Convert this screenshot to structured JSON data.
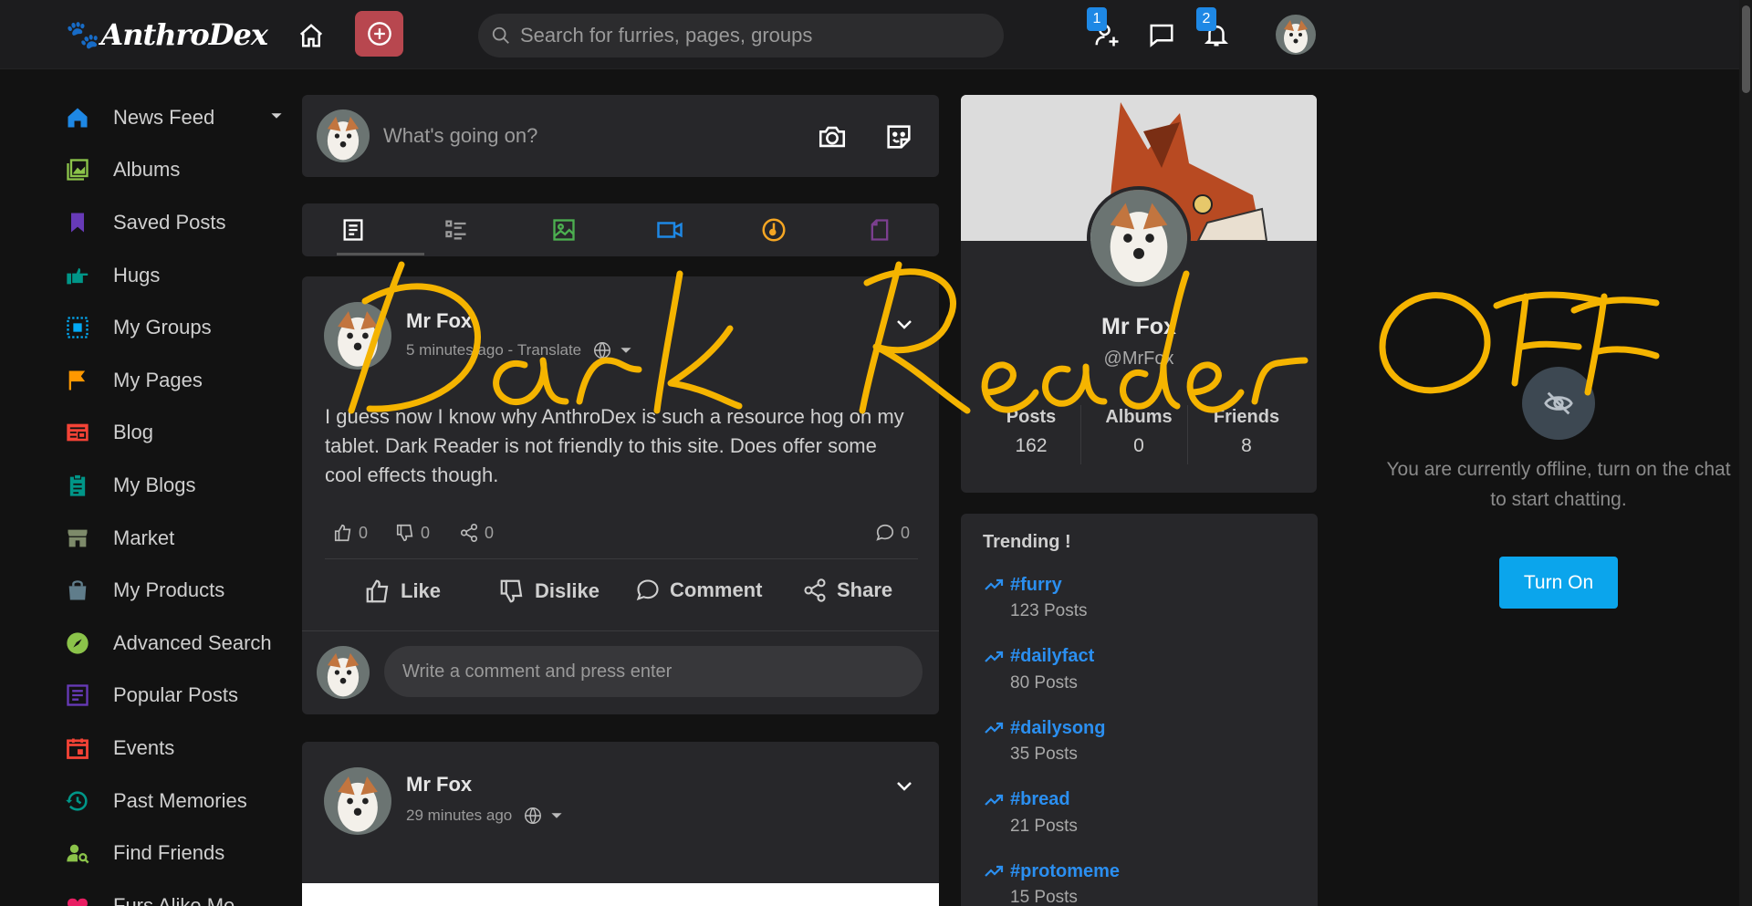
{
  "header": {
    "logo_text": "AnthroDex",
    "search_placeholder": "Search for furries, pages, groups",
    "friend_requests_badge": "1",
    "notifications_badge": "2"
  },
  "sidebar": {
    "items": [
      {
        "label": "News Feed",
        "icon": "home-icon",
        "color": "#1e88e5"
      },
      {
        "label": "Albums",
        "icon": "albums-icon",
        "color": "#8bc34a"
      },
      {
        "label": "Saved Posts",
        "icon": "bookmark-icon",
        "color": "#673ab7"
      },
      {
        "label": "Hugs",
        "icon": "hand-point-icon",
        "color": "#009688"
      },
      {
        "label": "My Groups",
        "icon": "groups-icon",
        "color": "#03a9f4"
      },
      {
        "label": "My Pages",
        "icon": "flag-icon",
        "color": "#ff9800"
      },
      {
        "label": "Blog",
        "icon": "newspaper-icon",
        "color": "#f44336"
      },
      {
        "label": "My Blogs",
        "icon": "clipboard-icon",
        "color": "#009688"
      },
      {
        "label": "Market",
        "icon": "store-icon",
        "color": "#7d8a6a"
      },
      {
        "label": "My Products",
        "icon": "shopping-bag-icon",
        "color": "#607d8b"
      },
      {
        "label": "Advanced Search",
        "icon": "compass-icon",
        "color": "#8bc34a"
      },
      {
        "label": "Popular Posts",
        "icon": "article-icon",
        "color": "#673ab7"
      },
      {
        "label": "Events",
        "icon": "calendar-icon",
        "color": "#f44336"
      },
      {
        "label": "Past Memories",
        "icon": "history-icon",
        "color": "#009688"
      },
      {
        "label": "Find Friends",
        "icon": "person-search-icon",
        "color": "#8bc34a"
      },
      {
        "label": "Furs Alike Me",
        "icon": "heart-icon",
        "color": "#e91e63"
      }
    ]
  },
  "composer": {
    "placeholder": "What's going on?"
  },
  "post1": {
    "author": "Mr Fox",
    "time": "5 minutes ago",
    "translate": "Translate",
    "body": "I guess now I know why AnthroDex is such a resource hog on my tablet. Dark Reader is not friendly to this site. Does offer some cool effects though.",
    "likes": "0",
    "dislikes": "0",
    "shares": "0",
    "comments": "0",
    "like_label": "Like",
    "dislike_label": "Dislike",
    "comment_label": "Comment",
    "share_label": "Share",
    "comment_placeholder": "Write a comment and press enter"
  },
  "post2": {
    "author": "Mr Fox",
    "time": "29 minutes ago"
  },
  "profile": {
    "name": "Mr Fox",
    "handle": "@MrFox",
    "stats": [
      {
        "label": "Posts",
        "value": "162"
      },
      {
        "label": "Albums",
        "value": "0"
      },
      {
        "label": "Friends",
        "value": "8"
      }
    ]
  },
  "trending": {
    "title": "Trending !",
    "items": [
      {
        "tag": "#furry",
        "count": "123 Posts"
      },
      {
        "tag": "#dailyfact",
        "count": "80 Posts"
      },
      {
        "tag": "#dailysong",
        "count": "35 Posts"
      },
      {
        "tag": "#bread",
        "count": "21 Posts"
      },
      {
        "tag": "#protomeme",
        "count": "15 Posts"
      }
    ]
  },
  "chat": {
    "message": "You are currently offline, turn on the chat to start chatting.",
    "button": "Turn On"
  },
  "annotation": {
    "left_text": "Dark Reader",
    "right_text": "OFF",
    "color": "#f5b400"
  }
}
